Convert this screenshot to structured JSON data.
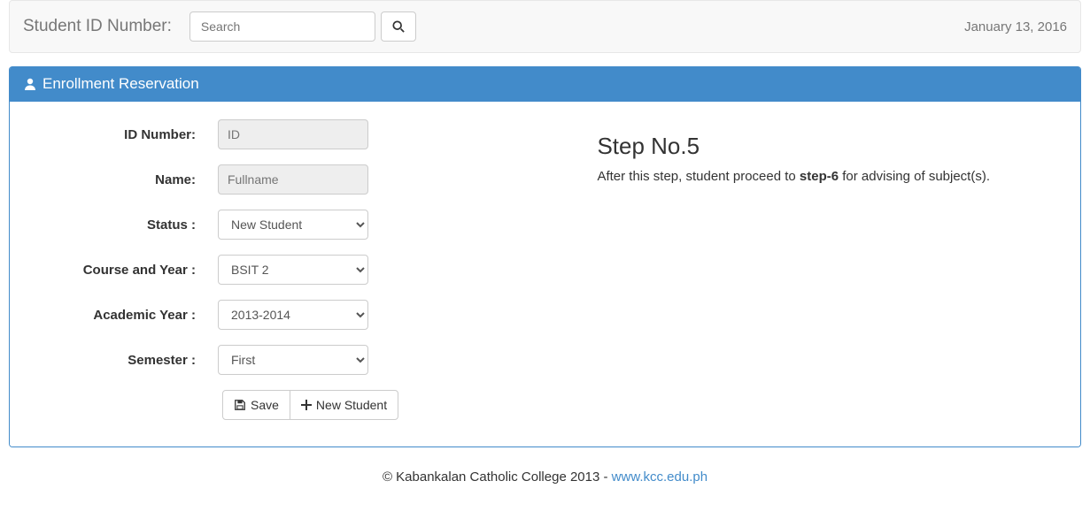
{
  "topbar": {
    "label": "Student ID Number:",
    "search_placeholder": "Search",
    "date": "January 13, 2016"
  },
  "panel": {
    "title": "Enrollment Reservation"
  },
  "form": {
    "id_label": "ID Number:",
    "id_placeholder": "ID",
    "name_label": "Name:",
    "name_placeholder": "Fullname",
    "status_label": "Status :",
    "status_value": "New Student",
    "course_label": "Course and Year :",
    "course_value": "BSIT 2",
    "acad_label": "Academic Year :",
    "acad_value": "2013-2014",
    "sem_label": "Semester :",
    "sem_value": "First",
    "save_label": "Save",
    "new_label": "New Student"
  },
  "info": {
    "title": "Step No.5",
    "text_pre": "After this step, student proceed to ",
    "text_bold": "step-6",
    "text_post": " for advising of subject(s)."
  },
  "footer": {
    "prefix": "© Kabankalan Catholic College 2013 - ",
    "link_text": "www.kcc.edu.ph"
  }
}
